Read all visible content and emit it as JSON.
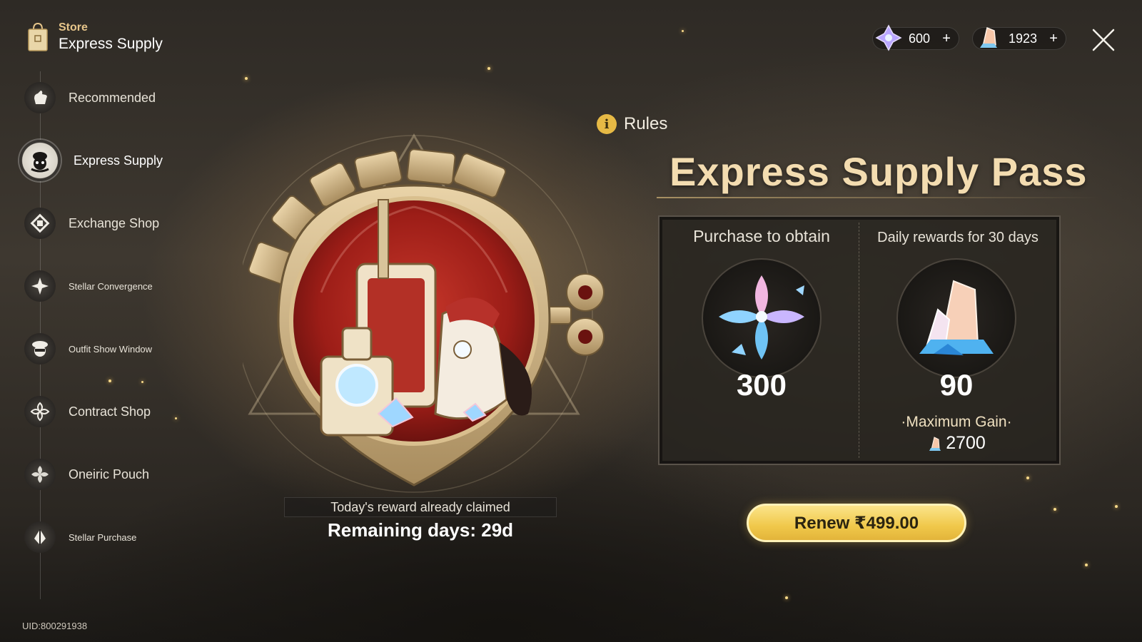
{
  "sidebar": {
    "category": "Store",
    "title": "Express Supply",
    "items": [
      {
        "label": "Recommended",
        "icon": "hand-icon",
        "small": false
      },
      {
        "label": "Express Supply",
        "icon": "conductor-icon",
        "small": false,
        "active": true
      },
      {
        "label": "Exchange Shop",
        "icon": "exchange-icon",
        "small": false
      },
      {
        "label": "Stellar Convergence",
        "icon": "star-flower-icon",
        "small": true
      },
      {
        "label": "Outfit Show Window",
        "icon": "outfit-icon",
        "small": true
      },
      {
        "label": "Contract Shop",
        "icon": "contract-icon",
        "small": false
      },
      {
        "label": "Oneiric Pouch",
        "icon": "oneiric-icon",
        "small": false
      },
      {
        "label": "Stellar Purchase",
        "icon": "stellar-purchase-icon",
        "small": true
      }
    ],
    "uid": "UID:800291938"
  },
  "currency": {
    "jade": {
      "value": "600",
      "plus": "+",
      "icon": "stellar-jade-icon",
      "color": "#b9a6ff"
    },
    "shards": {
      "value": "1923",
      "plus": "+",
      "icon": "oneiric-shard-icon",
      "color": "#f7c6a8"
    }
  },
  "pass": {
    "rules_label": "Rules",
    "rules_icon_glyph": "i",
    "title": "Express Supply Pass",
    "purchase": {
      "title": "Purchase to obtain",
      "amount": "300",
      "icon": "oneiric-shard-icon"
    },
    "daily": {
      "title": "Daily rewards for 30 days",
      "amount": "90",
      "icon": "stellar-jade-icon"
    },
    "max_gain_label": "·Maximum Gain·",
    "max_gain_value": "2700",
    "claimed_status": "Today's reward already claimed",
    "remaining": "Remaining days: 29d",
    "renew_label": "Renew ₹499.00"
  },
  "colors": {
    "accent_gold": "#f0c84a",
    "title_gold": "#f3dcb0",
    "medal_red": "#a8201a",
    "panel_bg": "#26231f"
  }
}
